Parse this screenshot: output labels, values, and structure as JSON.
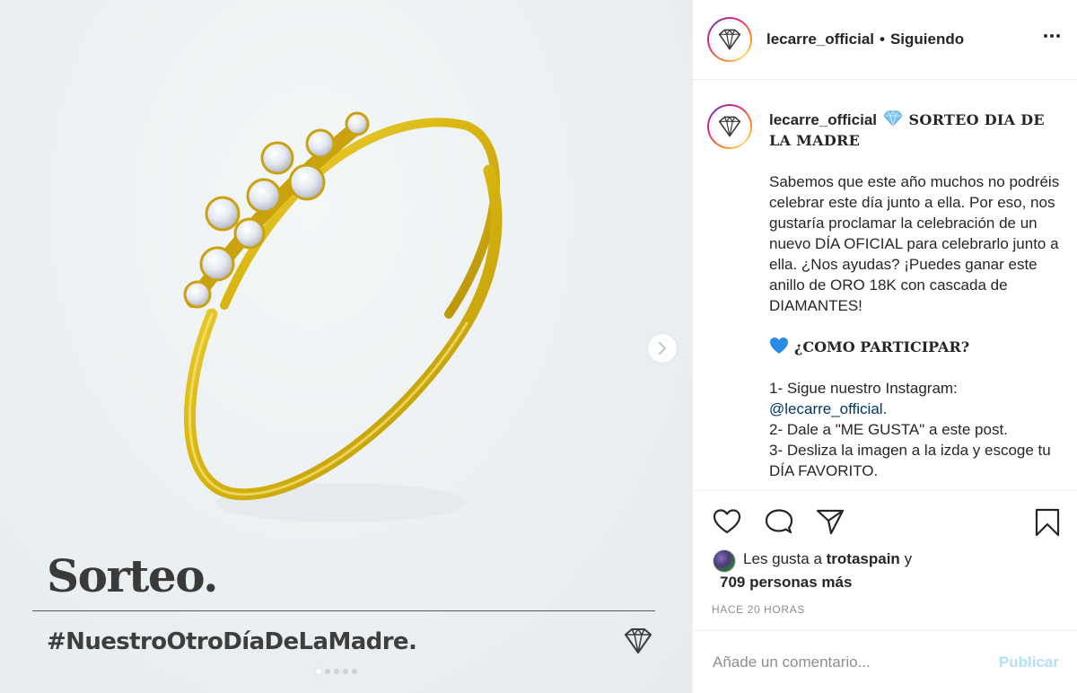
{
  "media": {
    "overlay_title": "Sorteo.",
    "hashtag": "#NuestroOtroDíaDeLaMadre.",
    "next_icon": "chevron-right-icon",
    "carousel_total": 5,
    "carousel_current": 1
  },
  "header": {
    "username": "lecarre_official",
    "separator": "•",
    "follow_status": "Siguiendo",
    "more_icon": "more-horizontal-icon"
  },
  "caption": {
    "username": "lecarre_official",
    "title": "SORTEO DIA DE LA MADRE",
    "paragraph": "Sabemos que este año muchos no podréis celebrar este día junto a ella. Por eso, nos gustaría proclamar la celebración de un nuevo DÍA OFICIAL para celebrarlo junto a ella. ¿Nos ayudas? ¡Puedes ganar este anillo de ORO 18K con cascada de DIAMANTES!",
    "participate_heading": "¿COMO PARTICIPAR?",
    "step1_text": "1- Sigue nuestro Instagram:",
    "step1_link": "@lecarre_official",
    "step1_suffix": ".",
    "step2": "2- Dale a \"ME GUSTA\" a este post.",
    "step3": "3- Desliza la imagen a la izda y escoge tu DÍA FAVORITO."
  },
  "actions": {
    "like_icon": "heart-icon",
    "comment_icon": "comment-icon",
    "share_icon": "send-icon",
    "save_icon": "bookmark-icon"
  },
  "likes": {
    "prefix": "Les gusta a",
    "first_user": "trotaspain",
    "conjunction": "y",
    "others": "709 personas más"
  },
  "timestamp": "HACE 20 HORAS",
  "comment": {
    "placeholder": "Añade un comentario...",
    "publish_label": "Publicar"
  },
  "colors": {
    "link": "#00376b",
    "publish_disabled": "#b2dffc",
    "meta_gray": "#8e8e8e",
    "text": "#262626",
    "gold": "#d6b512"
  }
}
